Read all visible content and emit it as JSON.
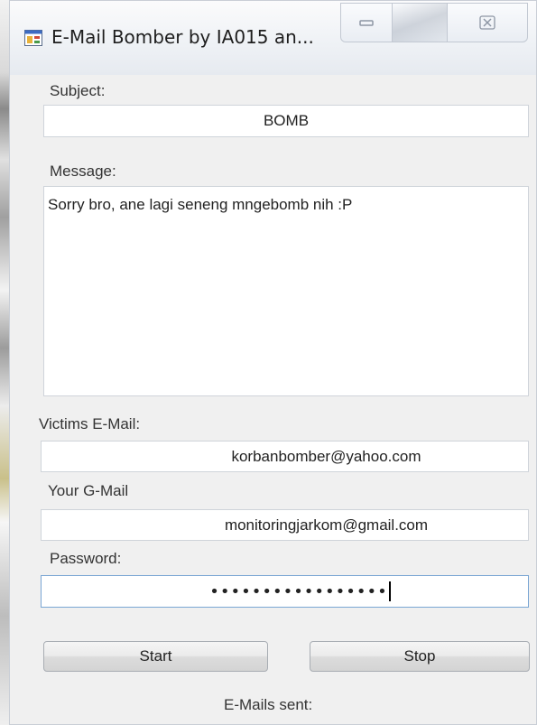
{
  "window": {
    "title": "E-Mail Bomber by IA015 an..."
  },
  "titlebar": {
    "icons": {
      "app": "app-window-icon",
      "minimize": "minimize-icon",
      "close": "close-icon"
    },
    "close_glyph": "☒"
  },
  "form": {
    "subject_label": "Subject:",
    "subject_value": "BOMB",
    "message_label": "Message:",
    "message_value": "Sorry bro, ane lagi seneng mngebomb nih :P",
    "victim_label": "Victims E-Mail:",
    "victim_value": "korbanbomber@yahoo.com",
    "gmail_label": "Your G-Mail",
    "gmail_value": "monitoringjarkom@gmail.com",
    "password_label": "Password:",
    "password_masked": "•••••••••••••••••"
  },
  "buttons": {
    "start_label": "Start",
    "stop_label": "Stop"
  },
  "status": {
    "sent_label": "E-Mails sent:"
  },
  "colors": {
    "window_bg": "#f0f0f0",
    "field_border": "#cfd4da",
    "focus_border": "#7aa6d4"
  }
}
